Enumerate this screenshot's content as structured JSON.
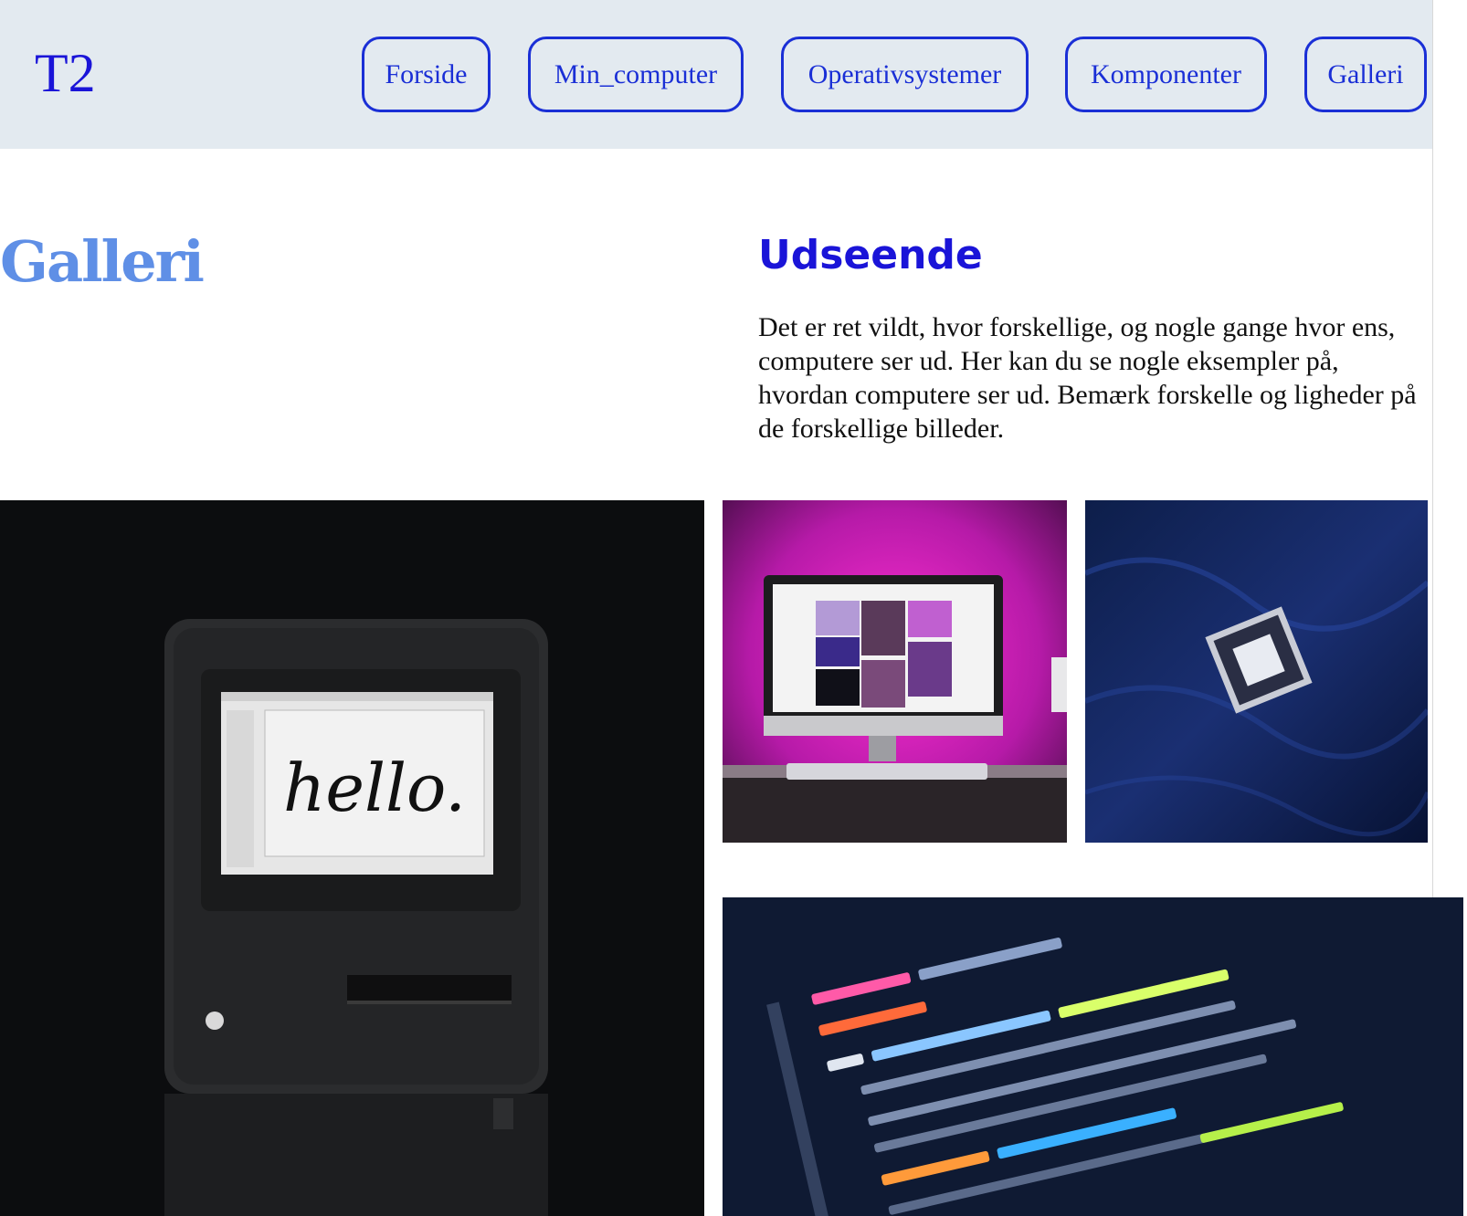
{
  "site": {
    "logo": "T2"
  },
  "nav": {
    "items": [
      {
        "label": "Forside"
      },
      {
        "label": "Min_computer"
      },
      {
        "label": "Operativsystemer"
      },
      {
        "label": "Komponenter"
      },
      {
        "label": "Galleri"
      }
    ]
  },
  "page": {
    "title": "Galleri"
  },
  "section": {
    "title": "Udseende",
    "text": "Det er ret vildt, hvor forskellige, og nogle gange hvor ens, computere ser ud. Her kan du se nogle eksempler på, hvordan computere ser ud. Bemærk forskelle og ligheder på de forskellige billeder."
  },
  "gallery": {
    "images": [
      {
        "name": "vintage-macintosh-photo",
        "screen_text": "hello."
      },
      {
        "name": "imac-pink-light-photo"
      },
      {
        "name": "cpu-chip-photo"
      },
      {
        "name": "code-screen-photo"
      }
    ]
  },
  "colors": {
    "accent": "#1a2fd6",
    "title": "#5f8fe6",
    "header_bg": "#e3eaf0"
  }
}
